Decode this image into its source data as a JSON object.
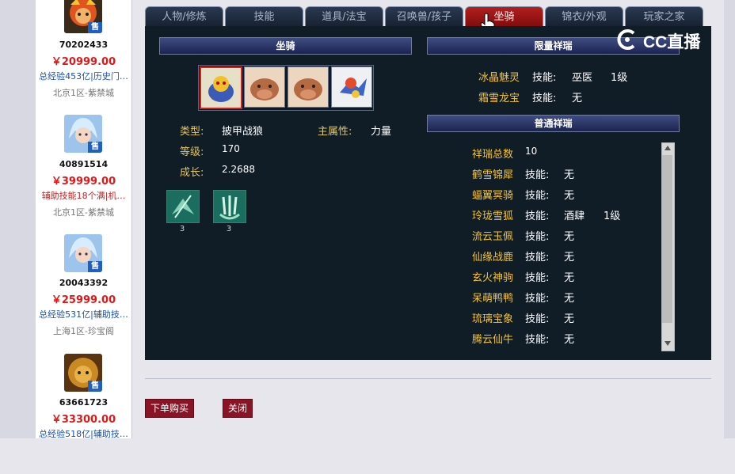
{
  "listing": [
    {
      "id": "70202433",
      "price": "￥20999.00",
      "desc": "总经验453亿|历史门…",
      "server": "北京1区-紫禁城",
      "desc_color": "#1b4fb5",
      "sell_badge": "售"
    },
    {
      "id": "40891514",
      "price": "￥39999.00",
      "desc": "辅助技能18个满|机…",
      "server": "北京1区-紫禁城",
      "desc_color": "#cc2020",
      "sell_badge": "售"
    },
    {
      "id": "20043392",
      "price": "￥25999.00",
      "desc": "总经验531亿|辅助技…",
      "server": "上海1区-珍宝阁",
      "desc_color": "#1b4fb5",
      "sell_badge": "售"
    },
    {
      "id": "63661723",
      "price": "￥33300.00",
      "desc": "总经验518亿|辅助技…",
      "server": "",
      "desc_color": "#1b4fb5",
      "sell_badge": "售"
    }
  ],
  "tabs": [
    {
      "label": "人物/修炼"
    },
    {
      "label": "技能"
    },
    {
      "label": "道具/法宝"
    },
    {
      "label": "召唤兽/孩子"
    },
    {
      "label": "坐骑",
      "active": true
    },
    {
      "label": "锦衣/外观"
    },
    {
      "label": "玩家之家"
    }
  ],
  "mount": {
    "section_title": "坐骑",
    "type_label": "类型:",
    "type_value": "披甲战狼",
    "main_attr_label": "主属性:",
    "main_attr_value": "力量",
    "level_label": "等级:",
    "level_value": "170",
    "growth_label": "成长:",
    "growth_value": "2.2688",
    "skills": [
      {
        "count": "3",
        "icon": "wing-skill-icon"
      },
      {
        "count": "3",
        "icon": "claw-skill-icon"
      }
    ]
  },
  "limited": {
    "title": "限量祥瑞",
    "rows": [
      {
        "name": "冰晶魅灵",
        "key": "技能:",
        "value": "巫医",
        "level": "1级"
      },
      {
        "name": "霜雪龙宝",
        "key": "技能:",
        "value": "无",
        "level": ""
      }
    ]
  },
  "normal": {
    "title": "普通祥瑞",
    "total_label": "祥瑞总数",
    "total_value": "10",
    "rows": [
      {
        "name": "鹤雪锦犀",
        "key": "技能:",
        "value": "无",
        "level": ""
      },
      {
        "name": "蝠翼冥骑",
        "key": "技能:",
        "value": "无",
        "level": ""
      },
      {
        "name": "玲珑雪狐",
        "key": "技能:",
        "value": "酒肆",
        "level": "1级"
      },
      {
        "name": "流云玉佩",
        "key": "技能:",
        "value": "无",
        "level": ""
      },
      {
        "name": "仙缘战鹿",
        "key": "技能:",
        "value": "无",
        "level": ""
      },
      {
        "name": "玄火神驹",
        "key": "技能:",
        "value": "无",
        "level": ""
      },
      {
        "name": "呆萌鸭鸭",
        "key": "技能:",
        "value": "无",
        "level": ""
      },
      {
        "name": "琉璃宝象",
        "key": "技能:",
        "value": "无",
        "level": ""
      },
      {
        "name": "腾云仙牛",
        "key": "技能:",
        "value": "无",
        "level": ""
      }
    ]
  },
  "buttons": {
    "order": "下单购买",
    "close": "关闭"
  },
  "watermark": {
    "text": "CC直播"
  },
  "colors": {
    "price": "#e01818",
    "gold": "#e6c65a",
    "active_tab": "#b31e1e",
    "panel_bg": "#101c26"
  }
}
